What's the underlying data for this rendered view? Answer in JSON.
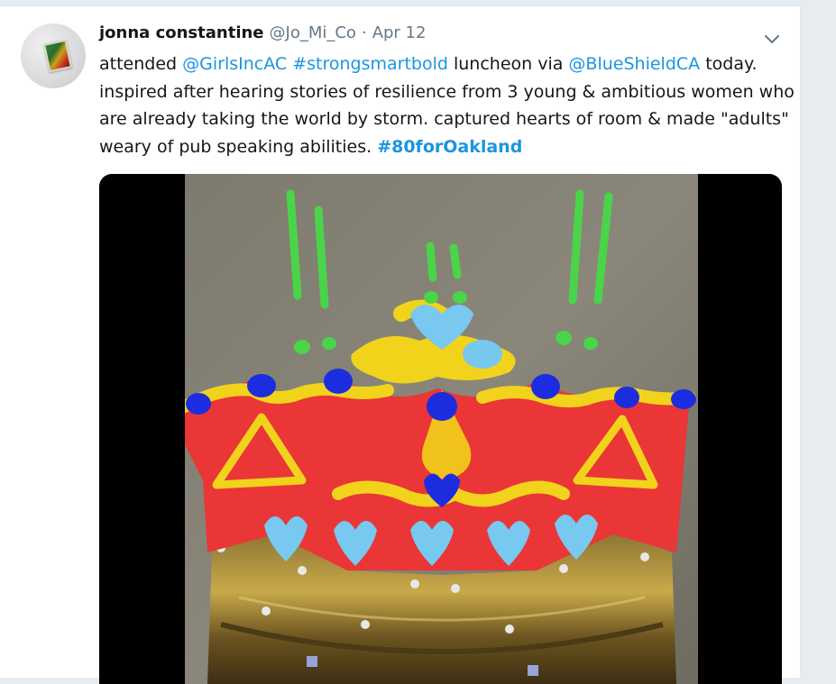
{
  "tweet": {
    "author_name": "jonna constantine",
    "author_handle": "@Jo_Mi_Co",
    "separator": "·",
    "date": "Apr 12",
    "text": {
      "l1_pre": "attended ",
      "mention_girlsinc": "@GirlsIncAC",
      "space1": " ",
      "hashtag_strongsmartbold": "#strongsmartbold",
      "l1_mid": " luncheon via ",
      "mention_blueshield": "@BlueShieldCA",
      "l1_post": " today.",
      "l2": "inspired after hearing stories of resilience from 3 young & ambitious women who",
      "l3": "are already taking the world by storm. captured hearts of room & made \"adults\"",
      "l4_pre": "weary of pub speaking abilities. ",
      "hashtag_80foroakland": "#80forOakland"
    }
  },
  "icons": {
    "more": "chevron-down-icon",
    "avatar": "profile-avatar"
  },
  "colors": {
    "link": "#1b95e0",
    "text": "#14171a",
    "muted": "#657786"
  }
}
